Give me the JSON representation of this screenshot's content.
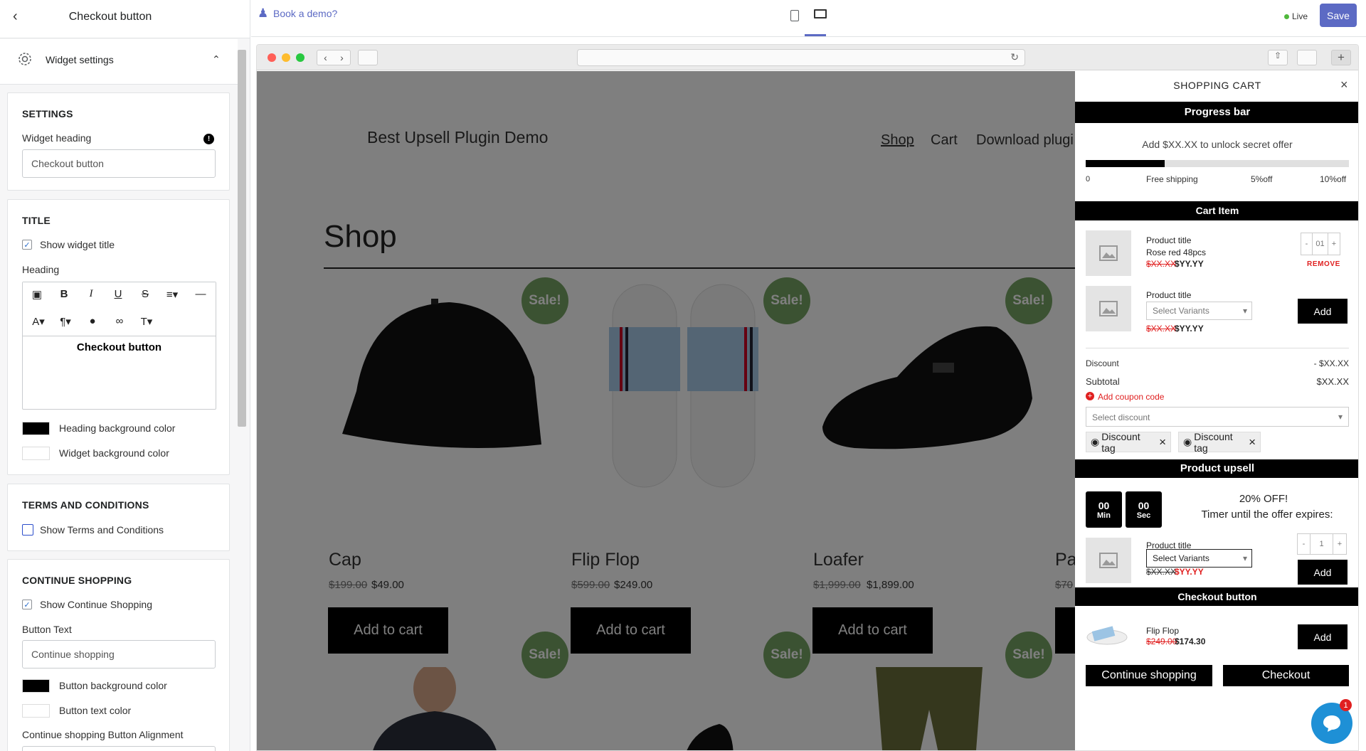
{
  "sidebar": {
    "title": "Checkout button",
    "widget_settings": "Widget settings",
    "settings": {
      "title": "SETTINGS",
      "widget_heading_label": "Widget heading",
      "widget_heading_value": "Checkout button"
    },
    "title_section": {
      "title": "TITLE",
      "show_widget_title": "Show widget title",
      "heading_label": "Heading",
      "editor_text": "Checkout button",
      "heading_bg": "Heading background color",
      "widget_bg": "Widget background color",
      "heading_bg_color": "#000000",
      "widget_bg_color": "#ffffff"
    },
    "terms": {
      "title": "TERMS AND CONDITIONS",
      "show_terms": "Show Terms and Conditions"
    },
    "continue": {
      "title": "CONTINUE SHOPPING",
      "show_continue": "Show Continue Shopping",
      "button_text_label": "Button Text",
      "button_text_value": "Continue shopping",
      "btn_bg": "Button background color",
      "btn_text": "Button text color",
      "alignment": "Continue shopping Button Alignment",
      "btn_bg_color": "#000000",
      "btn_text_color": "#ffffff"
    }
  },
  "topbar": {
    "book_demo": "Book a demo?",
    "live": "Live",
    "save": "Save",
    "accent": "#5c6ac4"
  },
  "site": {
    "brand": "Best Upsell Plugin Demo",
    "nav": [
      "Shop",
      "Cart",
      "Download plugi"
    ],
    "heading": "Shop",
    "sale_label": "Sale!",
    "add_to_cart": "Add to cart",
    "products": [
      {
        "name": "Cap",
        "old": "$199.00",
        "price": "$49.00"
      },
      {
        "name": "Flip Flop",
        "old": "$599.00",
        "price": "$249.00"
      },
      {
        "name": "Loafer",
        "old": "$1,999.00",
        "price": "$1,899.00"
      },
      {
        "name": "Pa",
        "old": "$70",
        "price": ""
      }
    ]
  },
  "cart": {
    "title": "SHOPPING CART",
    "progress": {
      "heading": "Progress bar",
      "message": "Add $XX.XX to unlock secret offer",
      "fill": 0.3,
      "milestones": [
        "0",
        "Free shipping",
        "5%off",
        "10%off"
      ]
    },
    "cart_item": {
      "heading": "Cart Item",
      "item1": {
        "title": "Product title",
        "variant": "Rose red 48pcs",
        "old": "$XX.XX",
        "price": "$YY.YY",
        "qty": "01",
        "remove": "REMOVE"
      },
      "item2": {
        "title": "Product title",
        "select": "Select Variants",
        "old": "$XX.XX",
        "price": "$YY.YY",
        "add": "Add"
      }
    },
    "discount_label": "Discount",
    "discount_value": "- $XX.XX",
    "subtotal_label": "Subtotal",
    "subtotal_value": "$XX.XX",
    "coupon": "Add coupon code",
    "select_discount": "Select discount",
    "tags": [
      "Discount tag",
      "Discount tag"
    ],
    "upsell": {
      "heading": "Product upsell",
      "min": "00",
      "min_label": "Min",
      "sec": "00",
      "sec_label": "Sec",
      "offer": "20% OFF!",
      "timer_text": "Timer until the offer expires:",
      "title": "Product title",
      "select": "Select Variants",
      "old": "$XX.XX",
      "price": "$YY.YY",
      "qty": "1",
      "add": "Add"
    },
    "checkout": {
      "heading": "Checkout button",
      "product": "Flip Flop",
      "old": "$249.00",
      "price": "$174.30",
      "add": "Add",
      "continue": "Continue shopping",
      "checkout": "Checkout"
    },
    "chat_badge": "1"
  }
}
